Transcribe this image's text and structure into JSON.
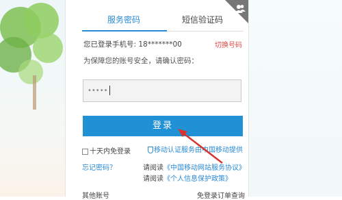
{
  "tabs": {
    "password": "服务密码",
    "sms": "短信验证码"
  },
  "account": {
    "phone_prefix": "您已登录手机号: ",
    "phone_number": "18*******00",
    "switch_label": "切换号码"
  },
  "hint": "为保障您的账号安全，请确认密码：",
  "password_field": {
    "value": "•••••"
  },
  "login_button": "登录",
  "remember_label": "十天内免登录",
  "auth_note": "移动认证服务由中国移动提供",
  "forgot_label": "忘记密码？",
  "agreements": [
    {
      "prefix": "请阅读",
      "link": "《中国移动网站服务协议》"
    },
    {
      "prefix": "请阅读",
      "link": "《个人信息保护政策》"
    }
  ],
  "footer": {
    "other_accounts": "其他账号",
    "order_query": "免登录订单查询"
  },
  "colors": {
    "accent": "#2191d5",
    "link_red": "#e04848",
    "arrow": "#d8342e"
  },
  "icons": [
    "user-switch-icon",
    "shield-icon",
    "checkbox-icon",
    "red-arrow-icon"
  ]
}
